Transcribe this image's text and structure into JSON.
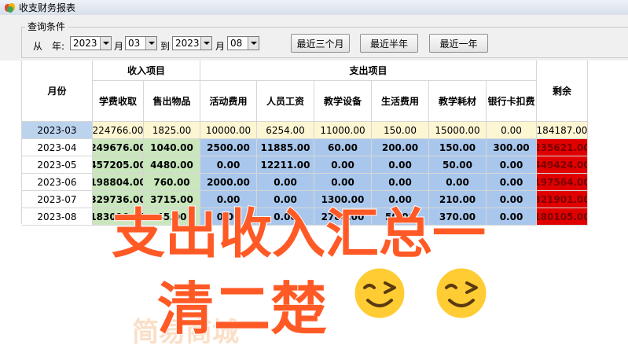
{
  "window": {
    "title": "收支财务报表"
  },
  "query": {
    "group_label": "查询条件",
    "from_label": "从　年:",
    "year_from": "2023",
    "month_label": "月",
    "month_from": "03",
    "to_label": "到",
    "year_to": "2023",
    "month_to": "08",
    "buttons": [
      "最近三个月",
      "最近半年",
      "最近一年"
    ]
  },
  "table": {
    "month_header": "月份",
    "income_group": "收入项目",
    "expense_group": "支出项目",
    "remaining_header": "剩余",
    "income_cols": [
      "学费收取",
      "售出物品"
    ],
    "expense_cols": [
      "活动费用",
      "人员工资",
      "教学设备",
      "生活费用",
      "教学耗材",
      "银行卡扣费"
    ],
    "rows": [
      {
        "month": "2023-03",
        "values": [
          "224766.00",
          "1825.00",
          "10000.00",
          "6254.00",
          "11000.00",
          "150.00",
          "15000.00",
          "0.00"
        ],
        "remaining": "184187.00"
      },
      {
        "month": "2023-04",
        "values": [
          "249676.00",
          "1040.00",
          "2500.00",
          "11885.00",
          "60.00",
          "200.00",
          "150.00",
          "300.00"
        ],
        "remaining": "235621.00"
      },
      {
        "month": "2023-05",
        "values": [
          "457205.00",
          "4480.00",
          "0.00",
          "12211.00",
          "0.00",
          "0.00",
          "50.00",
          "0.00"
        ],
        "remaining": "449424.00"
      },
      {
        "month": "2023-06",
        "values": [
          "198804.00",
          "760.00",
          "2000.00",
          "0.00",
          "0.00",
          "0.00",
          "0.00",
          "0.00"
        ],
        "remaining": "197564.00"
      },
      {
        "month": "2023-07",
        "values": [
          "329736.00",
          "3715.00",
          "0.00",
          "0.00",
          "1300.00",
          "0.00",
          "210.00",
          "0.00"
        ],
        "remaining": "321901.00"
      },
      {
        "month": "2023-08",
        "values": [
          "183010.00",
          "45.00",
          "0.00",
          "0.00",
          "2780.00",
          "50.00",
          "370.00",
          "0.00"
        ],
        "remaining": "180105.00"
      }
    ]
  },
  "overlay": {
    "line1": "支出收入汇总一",
    "line2": "清二楚",
    "faint": "简易商城",
    "emoji": "wink-face"
  },
  "colors": {
    "income": "#c9e6bd",
    "expense": "#a9c7ec",
    "remaining": "#e00000",
    "overlay_text": "#ff5a26"
  }
}
